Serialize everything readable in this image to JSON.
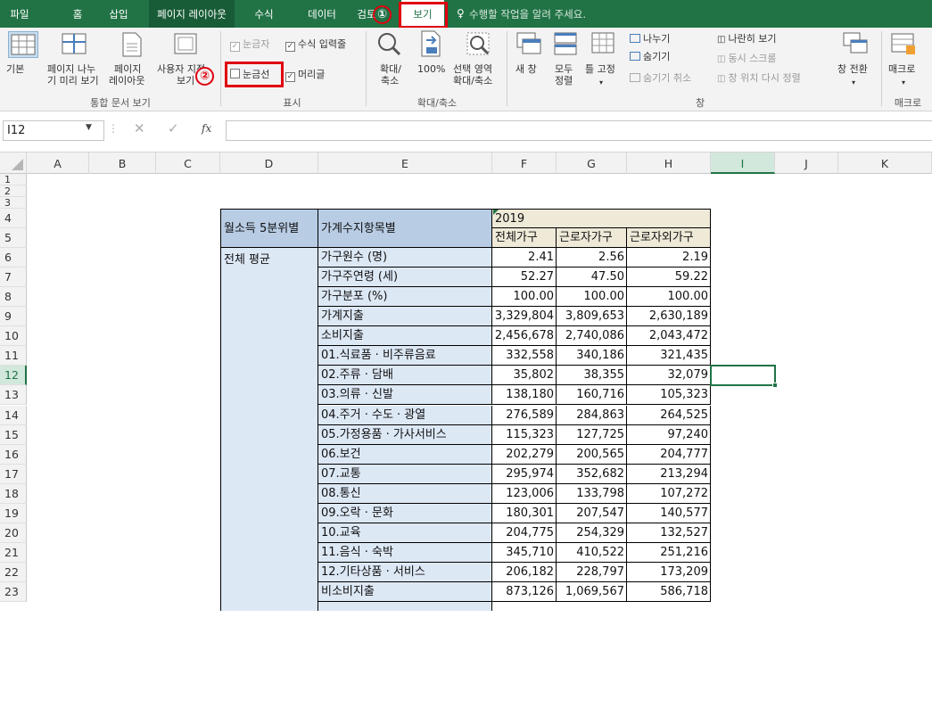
{
  "tabs": [
    {
      "label": "파일"
    },
    {
      "label": "홈"
    },
    {
      "label": "삽입"
    },
    {
      "label": "페이지 레이아웃"
    },
    {
      "label": "수식"
    },
    {
      "label": "데이터"
    },
    {
      "label": "검토"
    },
    {
      "label": "보기"
    }
  ],
  "tell_me": "수행할 작업을 알려 주세요.",
  "annotations": {
    "one": "①",
    "two": "②"
  },
  "ribbon": {
    "workbook_views": {
      "normal": "기본",
      "page_break_1": "페이지 나누",
      "page_break_2": "기 미리 보기",
      "page_layout_1": "페이지",
      "page_layout_2": "레이아웃",
      "custom_1": "사용자 지정",
      "custom_2": "보기",
      "group": "통합 문서 보기"
    },
    "show": {
      "ruler": "눈금자",
      "formula_bar": "수식 입력줄",
      "gridlines": "눈금선",
      "headings": "머리글",
      "group": "표시"
    },
    "zoom": {
      "zoom_1": "확대/",
      "zoom_2": "축소",
      "hundred": "100%",
      "selection_1": "선택 영역",
      "selection_2": "확대/축소",
      "group": "확대/축소"
    },
    "window": {
      "new": "새 창",
      "arrange_1": "모두",
      "arrange_2": "정렬",
      "freeze": "틀 고정",
      "split": "나누기",
      "hide": "숨기기",
      "unhide": "숨기기 취소",
      "side_by_side": "나란히 보기",
      "sync_scroll": "동시 스크롤",
      "reset_pos": "창 위치 다시 정렬",
      "switch": "창 전환",
      "group": "창"
    },
    "macros": {
      "label": "매크로",
      "group": "매크로"
    }
  },
  "formula_bar": {
    "name_box": "I12",
    "fx": "fx",
    "value": ""
  },
  "columns": [
    "A",
    "B",
    "C",
    "D",
    "E",
    "F",
    "G",
    "H",
    "I",
    "J",
    "K"
  ],
  "rows": [
    "1",
    "2",
    "3",
    "4",
    "5",
    "6",
    "7",
    "8",
    "9",
    "10",
    "11",
    "12",
    "13",
    "14",
    "15",
    "16",
    "17",
    "18",
    "19",
    "20",
    "21",
    "22",
    "23"
  ],
  "table": {
    "header_d": "월소득 5분위별",
    "header_e": "가계수지항목별",
    "year": "2019",
    "col_f": "전체가구",
    "col_g": "근로자가구",
    "col_h": "근로자외가구",
    "group_label": "전체 평균",
    "data": [
      {
        "item": "가구원수 (명)",
        "f": "2.41",
        "g": "2.56",
        "h": "2.19"
      },
      {
        "item": "가구주연령 (세)",
        "f": "52.27",
        "g": "47.50",
        "h": "59.22"
      },
      {
        "item": "가구분포 (%)",
        "f": "100.00",
        "g": "100.00",
        "h": "100.00"
      },
      {
        "item": "가계지출",
        "f": "3,329,804",
        "g": "3,809,653",
        "h": "2,630,189"
      },
      {
        "item": "소비지출",
        "f": "2,456,678",
        "g": "2,740,086",
        "h": "2,043,472"
      },
      {
        "item": "01.식료품 · 비주류음료",
        "f": "332,558",
        "g": "340,186",
        "h": "321,435"
      },
      {
        "item": "02.주류 · 담배",
        "f": "35,802",
        "g": "38,355",
        "h": "32,079"
      },
      {
        "item": "03.의류 · 신발",
        "f": "138,180",
        "g": "160,716",
        "h": "105,323"
      },
      {
        "item": "04.주거 · 수도 · 광열",
        "f": "276,589",
        "g": "284,863",
        "h": "264,525"
      },
      {
        "item": "05.가정용품 · 가사서비스",
        "f": "115,323",
        "g": "127,725",
        "h": "97,240"
      },
      {
        "item": "06.보건",
        "f": "202,279",
        "g": "200,565",
        "h": "204,777"
      },
      {
        "item": "07.교통",
        "f": "295,974",
        "g": "352,682",
        "h": "213,294"
      },
      {
        "item": "08.통신",
        "f": "123,006",
        "g": "133,798",
        "h": "107,272"
      },
      {
        "item": "09.오락 · 문화",
        "f": "180,301",
        "g": "207,547",
        "h": "140,577"
      },
      {
        "item": "10.교육",
        "f": "204,775",
        "g": "254,329",
        "h": "132,527"
      },
      {
        "item": "11.음식 · 숙박",
        "f": "345,710",
        "g": "410,522",
        "h": "251,216"
      },
      {
        "item": "12.기타상품 · 서비스",
        "f": "206,182",
        "g": "228,797",
        "h": "173,209"
      },
      {
        "item": "비소비지출",
        "f": "873,126",
        "g": "1,069,567",
        "h": "586,718"
      }
    ]
  },
  "colors": {
    "excel_green": "#217346",
    "highlight_red": "#e0000f"
  }
}
